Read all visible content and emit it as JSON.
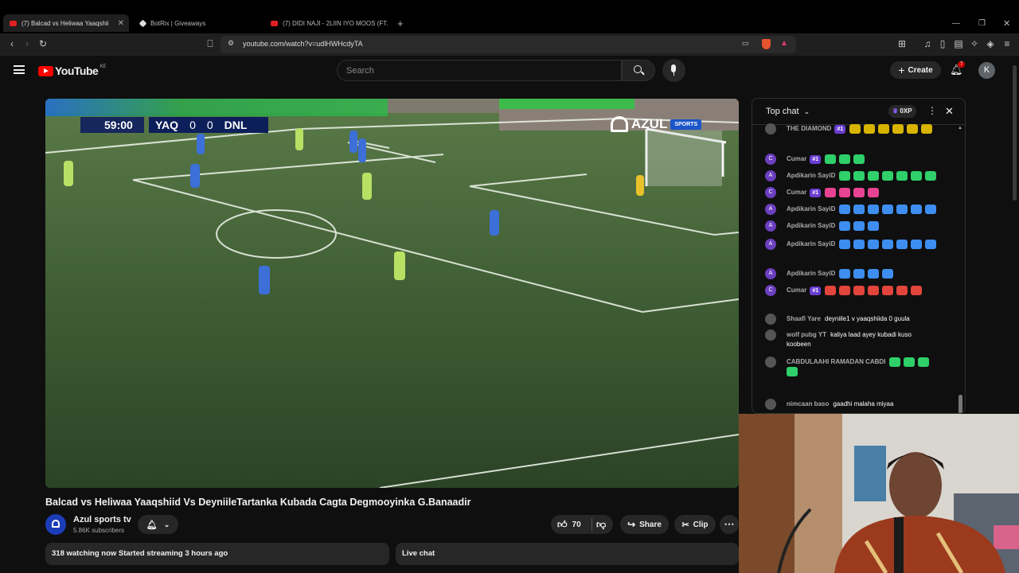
{
  "tabs": [
    {
      "label": "(7) Balcad vs Heliwaa Yaaqshii",
      "active": true
    },
    {
      "label": "BotRix | Giveaways",
      "active": false
    },
    {
      "label": "(7) DIDI NAJI - 2LIIN IYO MOOS (FT.",
      "active": false
    }
  ],
  "address_bar": {
    "url": "youtube.com/watch?v=udlHWHcdyTA"
  },
  "youtube": {
    "logo_text": "YouTube",
    "country": "KE",
    "search_placeholder": "Search",
    "create_label": "Create",
    "notification_count": "7",
    "avatar_letter": "K"
  },
  "scorebug": {
    "clock": "59:00",
    "home": "YAQ",
    "home_score": "0",
    "away_score": "0",
    "away": "DNL",
    "broadcaster": "AZUL",
    "broadcaster_sub": "SPORTS"
  },
  "video": {
    "title": "Balcad vs Heliwaa Yaaqshiid Vs DeyniileTartanka Kubada Cagta Degmooyinka G.Banaadir",
    "channel": "Azul sports tv",
    "subscribers": "5.86K subscribers",
    "likes": "70",
    "share_label": "Share",
    "clip_label": "Clip",
    "status": "318 watching now  Started streaming 3 hours ago",
    "live_chat_label": "Live chat"
  },
  "chat": {
    "header": "Top chat",
    "points": "0XP",
    "messages": [
      {
        "initial": "",
        "name": "THE DIAMOND",
        "badge": "#1",
        "text": "",
        "emotes": 6,
        "emote_color": "#d8b400"
      },
      {
        "initial": "C",
        "name": "Cumar",
        "badge": "#1",
        "text": "",
        "emotes": 3,
        "emote_color": "#2fcf6a"
      },
      {
        "initial": "A",
        "name": "Apdikarin SayiD",
        "badge": "",
        "text": "",
        "emotes": 7,
        "emote_color": "#2fcf6a"
      },
      {
        "initial": "C",
        "name": "Cumar",
        "badge": "#1",
        "text": "",
        "emotes": 4,
        "emote_color": "#e84393"
      },
      {
        "initial": "A",
        "name": "Apdikarin SayiD",
        "badge": "",
        "text": "",
        "emotes": 7,
        "emote_color": "#3d8ef0"
      },
      {
        "initial": "A",
        "name": "Apdikarin SayiD",
        "badge": "",
        "text": "",
        "emotes": 3,
        "emote_color": "#3d8ef0"
      },
      {
        "initial": "A",
        "name": "Apdikarin SayiD",
        "badge": "",
        "text": "",
        "emotes": 7,
        "emote_color": "#3d8ef0"
      },
      {
        "initial": "A",
        "name": "Apdikarin SayiD",
        "badge": "",
        "text": "",
        "emotes": 4,
        "emote_color": "#3d8ef0"
      },
      {
        "initial": "C",
        "name": "Cumar",
        "badge": "#1",
        "text": "",
        "emotes": 7,
        "emote_color": "#e2453c"
      },
      {
        "initial": "",
        "name": "Shaafi Yare",
        "badge": "",
        "text": "deyniile1 v yaaqshiida 0 guula",
        "emotes": 0,
        "emote_color": ""
      },
      {
        "initial": "",
        "name": "wolf pubg YT",
        "badge": "",
        "text": "kaliya laad ayey kubadi kuso",
        "text2": "koobeen",
        "emotes": 0,
        "emote_color": ""
      },
      {
        "initial": "",
        "name": "CABDULAAHI RAMADAN CABDI",
        "badge": "",
        "text": "",
        "emotes": 4,
        "emote_color": "#2fcf6a"
      },
      {
        "initial": "",
        "name": "nimcaan baso",
        "badge": "",
        "text": "gaadhi malaha miyaa",
        "emotes": 0,
        "emote_color": ""
      }
    ]
  }
}
